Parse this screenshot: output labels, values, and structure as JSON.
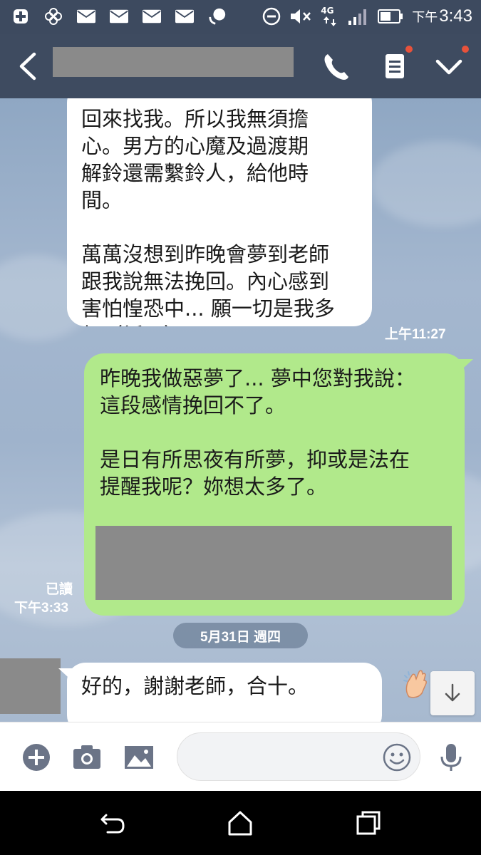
{
  "status_bar": {
    "ampm": "下午",
    "time": "3:43",
    "network": "4G"
  },
  "chat": {
    "messages": [
      {
        "side": "left",
        "text": "回來找我。所以我無須擔\n心。男方的心魔及過渡期\n解鈴還需繫鈴人，給他時\n間。\n\n萬萬沒想到昨晚會夢到老師\n跟我說無法挽回。內心感到\n害怕惶恐中... 願一切是我多\n想（祈願）",
        "time": "上午11:27"
      },
      {
        "side": "right",
        "text": "昨晚我做惡夢了... 夢中您對我說：\n這段感情挽回不了。\n\n是日有所思夜有所夢，抑或是法在\n提醒我呢？妳想太多了。",
        "read_label": "已讀",
        "time": "下午3:33"
      },
      {
        "side": "left",
        "text": "好的，謝謝老師，合十。",
        "emoji": "clapping-hands"
      }
    ],
    "date_separator": "5月31日 週四"
  },
  "composer": {
    "placeholder": ""
  },
  "colors": {
    "header": "#3e4b60",
    "bubble_out": "#b1e98b",
    "bubble_in": "#ffffff",
    "badge": "#e8523b"
  },
  "icons": {
    "header": [
      "back-chevron-icon",
      "phone-icon",
      "notes-icon",
      "checkmark-menu-icon"
    ],
    "composer": [
      "plus-icon",
      "camera-icon",
      "image-icon",
      "emoji-icon",
      "microphone-icon"
    ],
    "nav": [
      "back-icon",
      "home-icon",
      "recent-apps-icon"
    ]
  }
}
